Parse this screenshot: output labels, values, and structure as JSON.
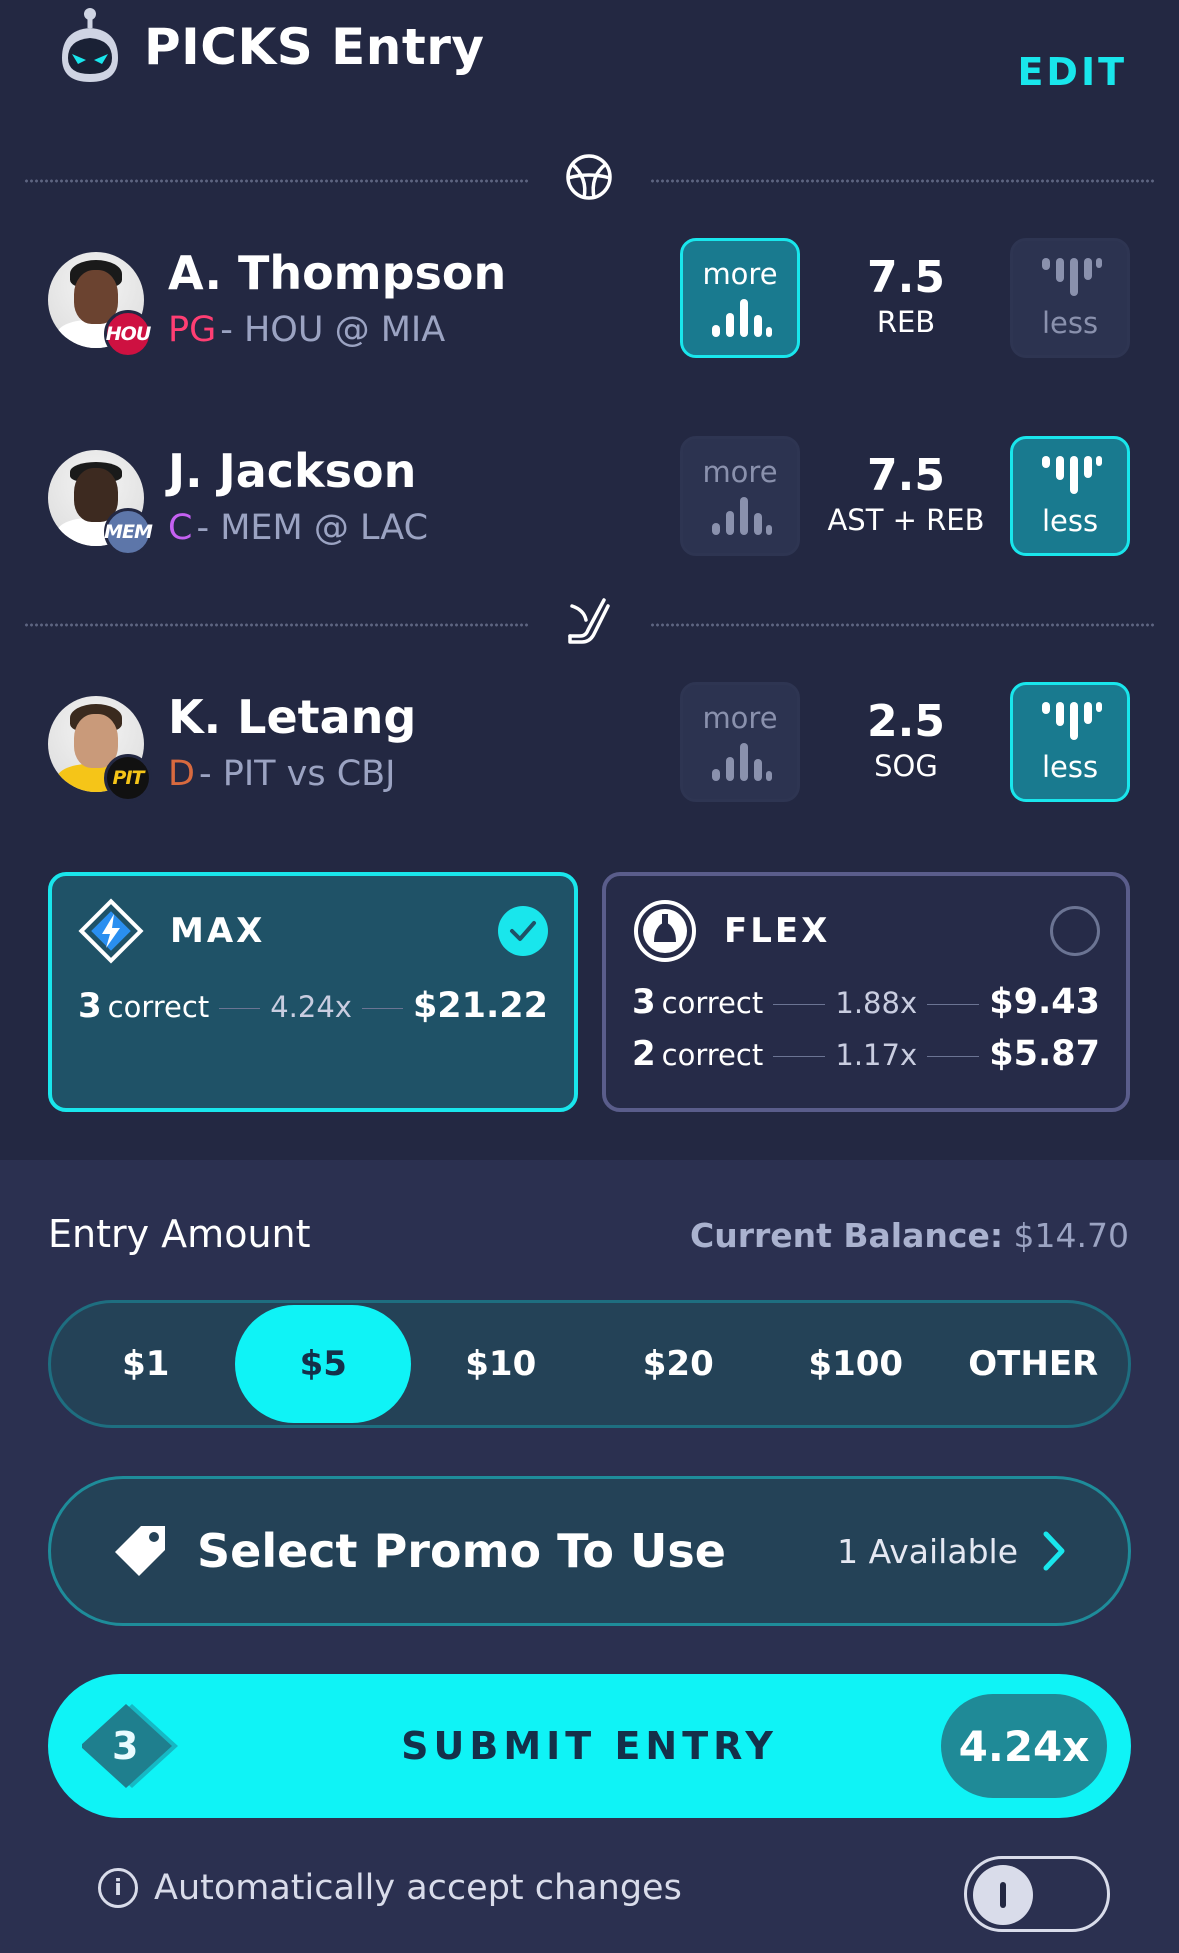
{
  "header": {
    "title": "PICKS Entry",
    "edit_label": "EDIT"
  },
  "players": [
    {
      "name": "A. Thompson",
      "position": "PG",
      "position_color": "#ff3e73",
      "matchup": "- HOU @ MIA",
      "team": "HOU",
      "team_color": "#ce1141",
      "line": "7.5",
      "stat": "REB",
      "more_label": "more",
      "less_label": "less",
      "selected": "more"
    },
    {
      "name": "J. Jackson",
      "position": "C",
      "position_color": "#c561f2",
      "matchup": "- MEM @ LAC",
      "team": "MEM",
      "team_color": "#5d76a9",
      "line": "7.5",
      "stat": "AST + REB",
      "more_label": "more",
      "less_label": "less",
      "selected": "less"
    },
    {
      "name": "K. Letang",
      "position": "D",
      "position_color": "#d86a3f",
      "matchup": "- PIT vs CBJ",
      "team": "PIT",
      "team_color": "#111111",
      "line": "2.5",
      "stat": "SOG",
      "more_label": "more",
      "less_label": "less",
      "selected": "less"
    }
  ],
  "cards": {
    "max": {
      "title": "MAX",
      "selected": true,
      "rows": [
        {
          "count": "3",
          "word": "correct",
          "mult": "4.24x",
          "amount": "$21.22"
        }
      ]
    },
    "flex": {
      "title": "FLEX",
      "selected": false,
      "rows": [
        {
          "count": "3",
          "word": "correct",
          "mult": "1.88x",
          "amount": "$9.43"
        },
        {
          "count": "2",
          "word": "correct",
          "mult": "1.17x",
          "amount": "$5.87"
        }
      ]
    }
  },
  "entry": {
    "label": "Entry Amount",
    "balance_label": "Current Balance:",
    "balance_value": "$14.70",
    "amounts": [
      "$1",
      "$5",
      "$10",
      "$20",
      "$100",
      "OTHER"
    ],
    "selected_amount": "$5"
  },
  "promo": {
    "label": "Select Promo To Use",
    "available": "1 Available"
  },
  "submit": {
    "count": "3",
    "label": "SUBMIT ENTRY",
    "multiplier": "4.24x"
  },
  "auto_accept": {
    "label": "Automatically accept changes",
    "enabled": false
  },
  "colors": {
    "accent": "#19e6ec",
    "background": "#232842"
  }
}
